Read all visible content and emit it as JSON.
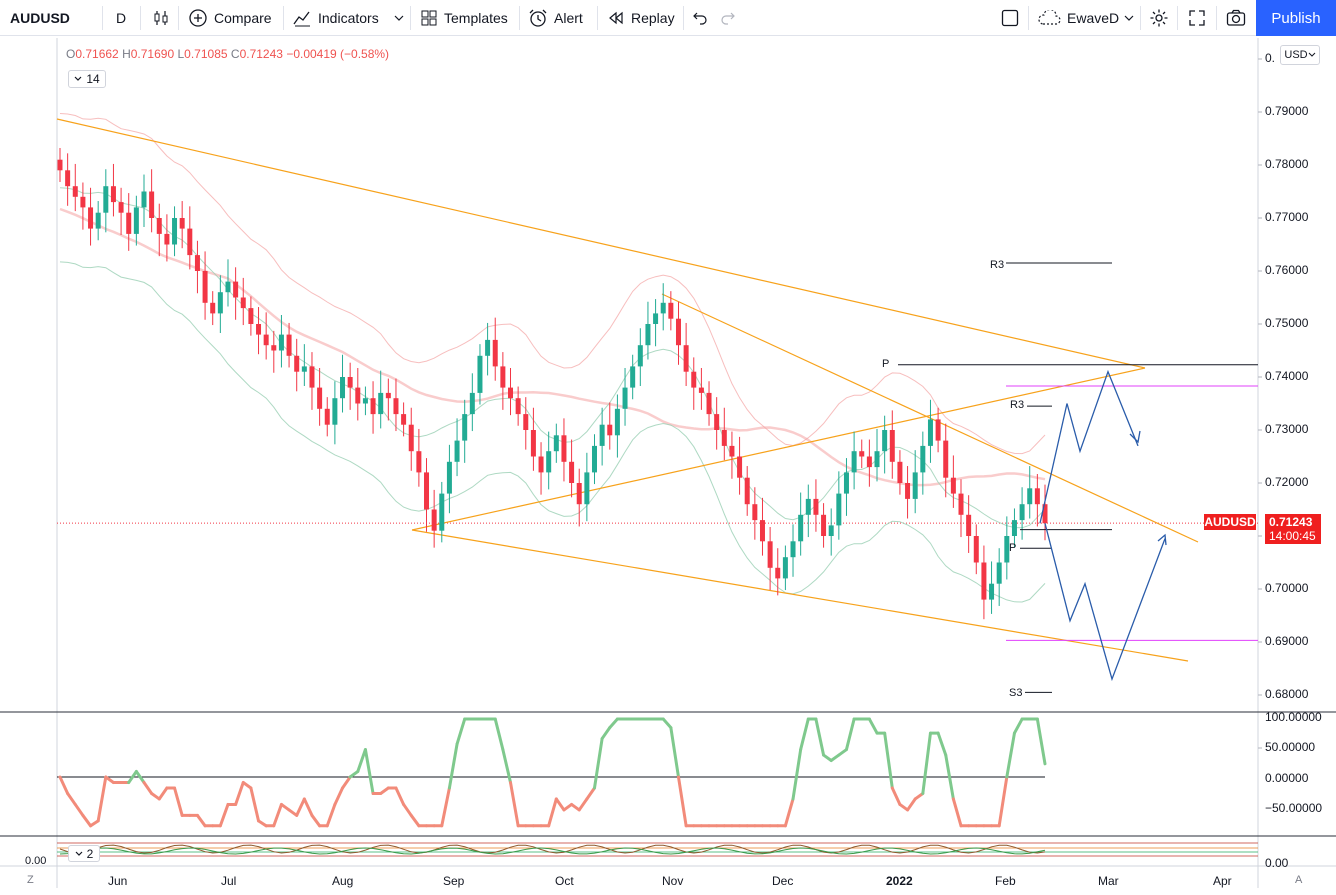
{
  "toolbar": {
    "symbol": "AUDUSD",
    "interval": "D",
    "compare": "Compare",
    "indicators": "Indicators",
    "templates": "Templates",
    "alert": "Alert",
    "replay": "Replay",
    "layout_name": "EwaveD",
    "publish": "Publish"
  },
  "legend": {
    "o_key": "O",
    "o_val": "0.71662",
    "h_key": "H",
    "h_val": "0.71690",
    "l_key": "L",
    "l_val": "0.71085",
    "c_key": "C",
    "c_val": "0.71243",
    "change": "−0.00419 (−0.58%)",
    "length_main": "14",
    "length_osc": "2"
  },
  "price_axis": {
    "currency": "USD",
    "top_partial": "0.",
    "ticks": [
      "0.79000",
      "0.78000",
      "0.77000",
      "0.76000",
      "0.75000",
      "0.74000",
      "0.73000",
      "0.72000",
      "0.70000",
      "0.69000",
      "0.68000"
    ],
    "symbol_tag": "AUDUSD",
    "last_price": "0.71243",
    "countdown": "14:00:45"
  },
  "osc_axis": {
    "ticks": [
      "100.00000",
      "50.00000",
      "0.00000",
      "−50.00000"
    ],
    "left_value": "0.00",
    "bottom_tick": "0.00"
  },
  "time_axis": {
    "labels": [
      "Jun",
      "Jul",
      "Aug",
      "Sep",
      "Oct",
      "Nov",
      "Dec",
      "2022",
      "Jan",
      "Feb",
      "Mar",
      "Apr"
    ],
    "left_btn": "Z",
    "right_btn": "A"
  },
  "pivot_labels": {
    "r3_upper": "R3",
    "p_upper": "P",
    "r3_lower": "R3",
    "p_lower": "P",
    "s3": "S3"
  },
  "colors": {
    "up": "#22ab94",
    "down": "#f23645",
    "accent": "#2962ff",
    "trendline": "#f7a21b",
    "projection": "#2a5caa",
    "pivot_pink": "#e040fb"
  },
  "chart_data": {
    "type": "candlestick",
    "symbol": "AUDUSD",
    "interval": "D",
    "ylim": [
      0.675,
      0.8
    ],
    "ohlc_last": {
      "open": 0.71662,
      "high": 0.7169,
      "low": 0.71085,
      "close": 0.71243
    },
    "closes": [
      0.779,
      0.776,
      0.774,
      0.772,
      0.768,
      0.771,
      0.776,
      0.773,
      0.771,
      0.767,
      0.772,
      0.775,
      0.77,
      0.767,
      0.765,
      0.77,
      0.768,
      0.763,
      0.76,
      0.754,
      0.752,
      0.756,
      0.758,
      0.755,
      0.753,
      0.75,
      0.748,
      0.746,
      0.745,
      0.748,
      0.744,
      0.741,
      0.742,
      0.738,
      0.734,
      0.731,
      0.736,
      0.74,
      0.738,
      0.735,
      0.736,
      0.733,
      0.737,
      0.736,
      0.733,
      0.731,
      0.726,
      0.722,
      0.715,
      0.711,
      0.718,
      0.724,
      0.728,
      0.733,
      0.737,
      0.744,
      0.747,
      0.742,
      0.738,
      0.736,
      0.733,
      0.73,
      0.725,
      0.722,
      0.726,
      0.729,
      0.724,
      0.72,
      0.716,
      0.722,
      0.727,
      0.731,
      0.729,
      0.734,
      0.738,
      0.742,
      0.746,
      0.75,
      0.752,
      0.754,
      0.751,
      0.746,
      0.741,
      0.738,
      0.737,
      0.733,
      0.73,
      0.727,
      0.725,
      0.721,
      0.716,
      0.713,
      0.709,
      0.704,
      0.702,
      0.706,
      0.709,
      0.714,
      0.717,
      0.714,
      0.71,
      0.712,
      0.718,
      0.722,
      0.726,
      0.725,
      0.723,
      0.726,
      0.73,
      0.724,
      0.72,
      0.717,
      0.722,
      0.727,
      0.732,
      0.728,
      0.721,
      0.718,
      0.714,
      0.71,
      0.705,
      0.698,
      0.701,
      0.705,
      0.71,
      0.713,
      0.716,
      0.719,
      0.716,
      0.7124
    ],
    "trendlines": [
      {
        "from": [
          "2021-05-20",
          0.789
        ],
        "to": [
          "2022-03-10",
          0.7418
        ]
      },
      {
        "from": [
          "2021-08-20",
          0.711
        ],
        "to": [
          "2022-03-10",
          0.7418
        ]
      },
      {
        "from": [
          "2021-08-20",
          0.711
        ],
        "to": [
          "2022-04-01",
          0.6865
        ]
      },
      {
        "from": [
          "2021-10-30",
          0.755
        ],
        "to": [
          "2022-03-25",
          0.709
        ]
      }
    ],
    "projection_path": [
      0.7124,
      0.735,
      0.726,
      0.741,
      0.727
    ],
    "projection_path_alt": [
      0.7124,
      0.694,
      0.701,
      0.683,
      0.7095
    ],
    "pivots": {
      "upper": {
        "R3": 0.7615,
        "P": 0.7423
      },
      "lower": {
        "R3": 0.7345,
        "P": 0.7077,
        "S3": 0.6805
      },
      "pink_levels": [
        0.7383,
        0.6903
      ]
    },
    "oscillator": {
      "name": "",
      "ylim": [
        -75,
        100
      ],
      "zero_line": 0
    }
  }
}
